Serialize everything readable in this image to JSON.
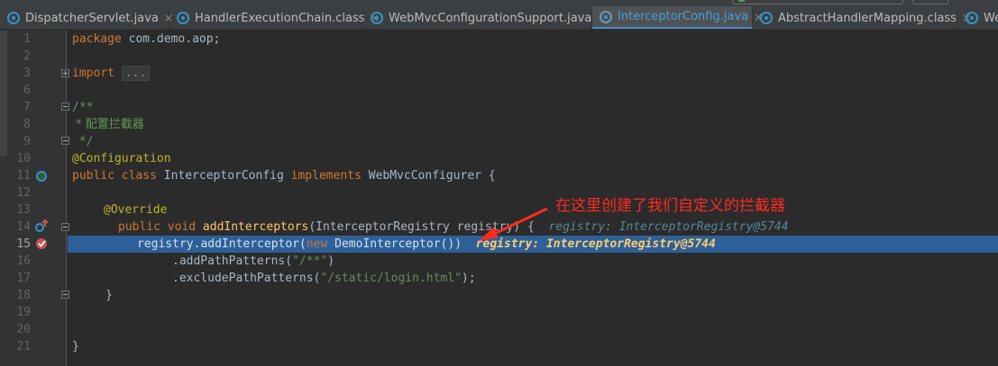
{
  "tabs": [
    {
      "label": "DispatcherServlet.java",
      "close": "×",
      "active": false
    },
    {
      "label": "HandlerExecutionChain.class",
      "close": "×",
      "active": false
    },
    {
      "label": "WebMvcConfigurationSupport.java",
      "close": "×",
      "active": false
    },
    {
      "label": "InterceptorConfig.java",
      "close": "×",
      "active": true
    },
    {
      "label": "AbstractHandlerMapping.class",
      "close": "×",
      "active": false
    },
    {
      "label": "We",
      "close": "",
      "active": false
    }
  ],
  "gutter": {
    "line_numbers": [
      "1",
      "2",
      "3",
      "6",
      "7",
      "8",
      "9",
      "10",
      "11",
      "12",
      "13",
      "14",
      "15",
      "16",
      "17",
      "18",
      "19",
      "20",
      "21"
    ],
    "current_line": "15"
  },
  "code": {
    "l1": {
      "kw": "package",
      "rest": " com.demo.aop;"
    },
    "l3": {
      "kw": "import",
      "folded": "..."
    },
    "l6": "/**",
    "l7": " * 配置拦截器",
    "l8": " */",
    "l9": "@Configuration",
    "l10": {
      "kw1": "public class",
      "name": " InterceptorConfig ",
      "kw2": "implements",
      "rest": " WebMvcConfigurer {"
    },
    "l12": "@Override",
    "l13": {
      "kw": "public void",
      "fn": "addInterceptors",
      "rest": "(InterceptorRegistry registry) {",
      "hint": "registry: InterceptorRegistry@5744"
    },
    "l14": {
      "pre": "registry.addInterceptor(",
      "kw": "new",
      "rest": " DemoInterceptor())",
      "hint": "registry: InterceptorRegistry@5744"
    },
    "l15": {
      "pre": ".addPathPatterns(",
      "str": "\"/**\"",
      "post": ")"
    },
    "l16": {
      "pre": ".excludePathPatterns(",
      "str": "\"/static/login.html\"",
      "post": ");"
    },
    "l17": "}",
    "l20": "}"
  },
  "annotation": {
    "text": "在这里创建了我们自定义的拦截器",
    "color": "#ff2b1e"
  },
  "colors": {
    "editor_bg": "#2b2b2b",
    "highlight_line": "#2d6099",
    "keyword": "#cc7832",
    "string": "#6a8759",
    "comment": "#629755",
    "annotation": "#bbb529",
    "method": "#ffc66d"
  }
}
